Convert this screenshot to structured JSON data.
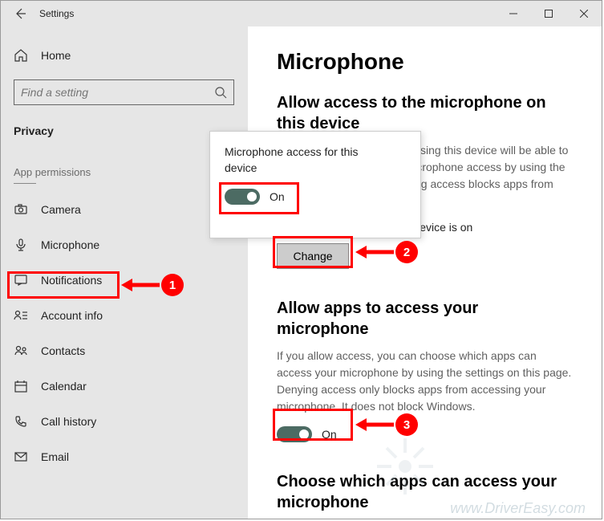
{
  "window": {
    "title": "Settings"
  },
  "sidebar": {
    "home": "Home",
    "search_placeholder": "Find a setting",
    "category": "Privacy",
    "subheader": "App permissions",
    "items": [
      {
        "label": "Camera"
      },
      {
        "label": "Microphone"
      },
      {
        "label": "Notifications"
      },
      {
        "label": "Account info"
      },
      {
        "label": "Contacts"
      },
      {
        "label": "Calendar"
      },
      {
        "label": "Call history"
      },
      {
        "label": "Email"
      }
    ]
  },
  "main": {
    "page_title": "Microphone",
    "section1": {
      "title": "Allow access to the microphone on this device",
      "desc": "If you allow access, people using this device will be able to choose if their apps have microphone access by using the settings on this page. Denying access blocks apps from accessing the microphone.",
      "status": "Microphone access for this device is on",
      "change_label": "Change"
    },
    "section2": {
      "title": "Allow apps to access your microphone",
      "desc": "If you allow access, you can choose which apps can access your microphone by using the settings on this page. Denying access only blocks apps from accessing your microphone. It does not block Windows.",
      "toggle_label": "On"
    },
    "section3": {
      "title": "Choose which apps can access your microphone"
    }
  },
  "popup": {
    "title": "Microphone access for this device",
    "toggle_label": "On"
  },
  "annotations": {
    "badge1": "1",
    "badge2": "2",
    "badge3": "3"
  },
  "watermark": "www.DriverEasy.com"
}
